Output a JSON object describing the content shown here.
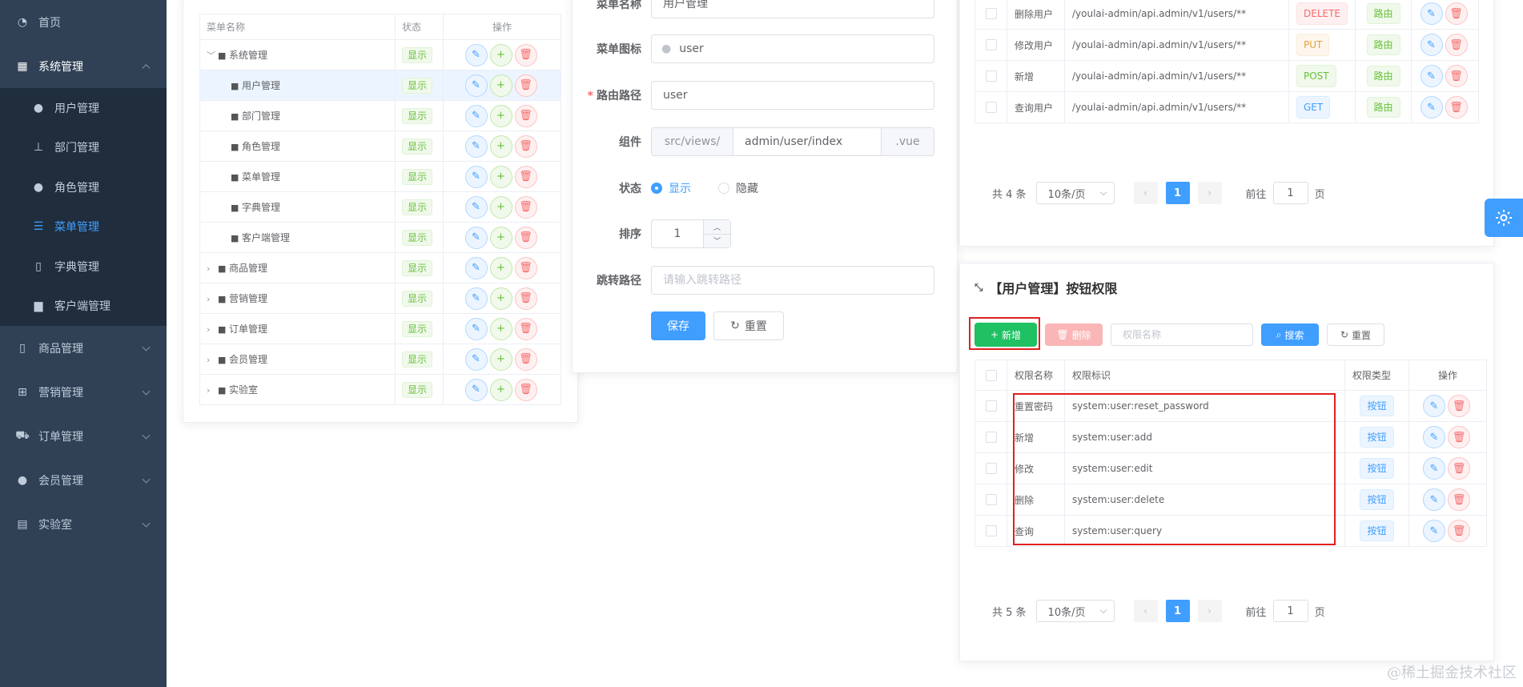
{
  "sidebar": {
    "items": [
      {
        "label": "首页",
        "icon": "dashboard-icon"
      },
      {
        "label": "系统管理",
        "icon": "grid-icon",
        "expanded": true
      },
      {
        "label": "商品管理",
        "icon": "phone-icon"
      },
      {
        "label": "营销管理",
        "icon": "marketing-icon"
      },
      {
        "label": "订单管理",
        "icon": "cart-icon"
      },
      {
        "label": "会员管理",
        "icon": "member-icon"
      },
      {
        "label": "实验室",
        "icon": "lab-icon"
      }
    ],
    "sub_items": [
      {
        "label": "用户管理",
        "icon": "user-icon"
      },
      {
        "label": "部门管理",
        "icon": "tree-icon"
      },
      {
        "label": "角色管理",
        "icon": "role-icon"
      },
      {
        "label": "菜单管理",
        "icon": "menu-list-icon",
        "active": true
      },
      {
        "label": "字典管理",
        "icon": "book-icon"
      },
      {
        "label": "客户端管理",
        "icon": "client-icon"
      }
    ]
  },
  "menu_table": {
    "headers": [
      "菜单名称",
      "状态",
      "操作"
    ],
    "rows": [
      {
        "name": "系统管理",
        "status": "显示",
        "expanded": true
      },
      {
        "name": "用户管理",
        "status": "显示",
        "child": true,
        "selected": true
      },
      {
        "name": "部门管理",
        "status": "显示",
        "child": true
      },
      {
        "name": "角色管理",
        "status": "显示",
        "child": true
      },
      {
        "name": "菜单管理",
        "status": "显示",
        "child": true
      },
      {
        "name": "字典管理",
        "status": "显示",
        "child": true
      },
      {
        "name": "客户端管理",
        "status": "显示",
        "child": true
      },
      {
        "name": "商品管理",
        "status": "显示"
      },
      {
        "name": "营销管理",
        "status": "显示"
      },
      {
        "name": "订单管理",
        "status": "显示"
      },
      {
        "name": "会员管理",
        "status": "显示"
      },
      {
        "name": "实验室",
        "status": "显示"
      }
    ]
  },
  "form": {
    "name_label": "菜单名称",
    "name_value": "用户管理",
    "icon_label": "菜单图标",
    "icon_value": "user",
    "path_label": "路由路径",
    "path_value": "user",
    "component_label": "组件",
    "component_prefix": "src/views/",
    "component_value": "admin/user/index",
    "component_suffix": ".vue",
    "status_label": "状态",
    "status_show": "显示",
    "status_hide": "隐藏",
    "sort_label": "排序",
    "sort_value": "1",
    "redirect_label": "跳转路径",
    "redirect_placeholder": "请输入跳转路径",
    "save": "保存",
    "reset": "重置"
  },
  "api_table": {
    "rows": [
      {
        "name": "删除用户",
        "path": "/youlai-admin/api.admin/v1/users/**",
        "method": "DELETE",
        "type": "路由"
      },
      {
        "name": "修改用户",
        "path": "/youlai-admin/api.admin/v1/users/**",
        "method": "PUT",
        "type": "路由"
      },
      {
        "name": "新增",
        "path": "/youlai-admin/api.admin/v1/users/**",
        "method": "POST",
        "type": "路由"
      },
      {
        "name": "查询用户",
        "path": "/youlai-admin/api.admin/v1/users/**",
        "method": "GET",
        "type": "路由"
      }
    ],
    "pager": {
      "total": "共 4 条",
      "size": "10条/页",
      "page": "1",
      "goto": "前往",
      "goto_value": "1",
      "unit": "页"
    }
  },
  "perm": {
    "title": "【用户管理】按钮权限",
    "add": "新增",
    "delete": "删除",
    "search_placeholder": "权限名称",
    "search": "搜索",
    "reset": "重置",
    "headers": [
      "权限名称",
      "权限标识",
      "权限类型",
      "操作"
    ],
    "rows": [
      {
        "name": "重置密码",
        "code": "system:user:reset_password",
        "type": "按钮"
      },
      {
        "name": "新增",
        "code": "system:user:add",
        "type": "按钮"
      },
      {
        "name": "修改",
        "code": "system:user:edit",
        "type": "按钮"
      },
      {
        "name": "删除",
        "code": "system:user:delete",
        "type": "按钮"
      },
      {
        "name": "查询",
        "code": "system:user:query",
        "type": "按钮"
      }
    ],
    "pager": {
      "total": "共 5 条",
      "size": "10条/页",
      "page": "1",
      "goto": "前往",
      "goto_value": "1",
      "unit": "页"
    }
  },
  "watermark": "@稀土掘金技术社区",
  "colors": {
    "primary": "#409eff",
    "success": "#67c23a",
    "danger": "#f56c6c",
    "sidebar": "#304156",
    "highlight": "#e02020"
  }
}
